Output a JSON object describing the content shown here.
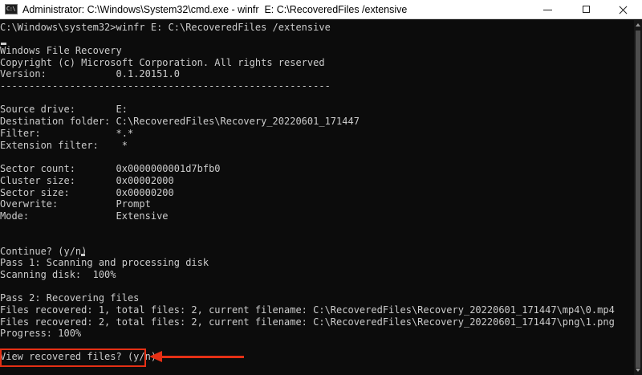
{
  "window": {
    "title": "Administrator: C:\\Windows\\System32\\cmd.exe - winfr  E: C:\\RecoveredFiles /extensive",
    "icon_text": "C:\\"
  },
  "console": {
    "prompt_line": "C:\\Windows\\system32>winfr E: C:\\RecoveredFiles /extensive",
    "tool_name": "Windows File Recovery",
    "copyright": "Copyright (c) Microsoft Corporation. All rights reserved",
    "version": "Version:            0.1.20151.0",
    "separator": "---------------------------------------------------------",
    "source_drive": "Source drive:       E:",
    "destination_folder": "Destination folder: C:\\RecoveredFiles\\Recovery_20220601_171447",
    "filter": "Filter:             *.*",
    "extension_filter": "Extension filter:    *",
    "sector_count": "Sector count:       0x0000000001d7bfb0",
    "cluster_size": "Cluster size:       0x00002000",
    "sector_size": "Sector size:        0x00000200",
    "overwrite": "Overwrite:          Prompt",
    "mode": "Mode:               Extensive",
    "continue_prompt": "Continue? (y/n)",
    "pass1_title": "Pass 1: Scanning and processing disk",
    "pass1_progress": "Scanning disk:  100%",
    "pass2_title": "Pass 2: Recovering files",
    "files_recovered_1": "Files recovered: 1, total files: 2, current filename: C:\\RecoveredFiles\\Recovery_20220601_171447\\mp4\\0.mp4",
    "files_recovered_2": "Files recovered: 2, total files: 2, current filename: C:\\RecoveredFiles\\Recovery_20220601_171447\\png\\1.png",
    "progress": "Progress: 100%",
    "view_prompt": "View recovered files? (y/n)"
  },
  "colors": {
    "console_background": "#0c0c0c",
    "console_text": "#cccccc",
    "annotation_red": "#e53015"
  },
  "icons": [
    "cmd-app-icon",
    "minimize-icon",
    "maximize-icon",
    "close-icon",
    "scroll-up-arrow-icon",
    "scroll-down-arrow-icon"
  ]
}
